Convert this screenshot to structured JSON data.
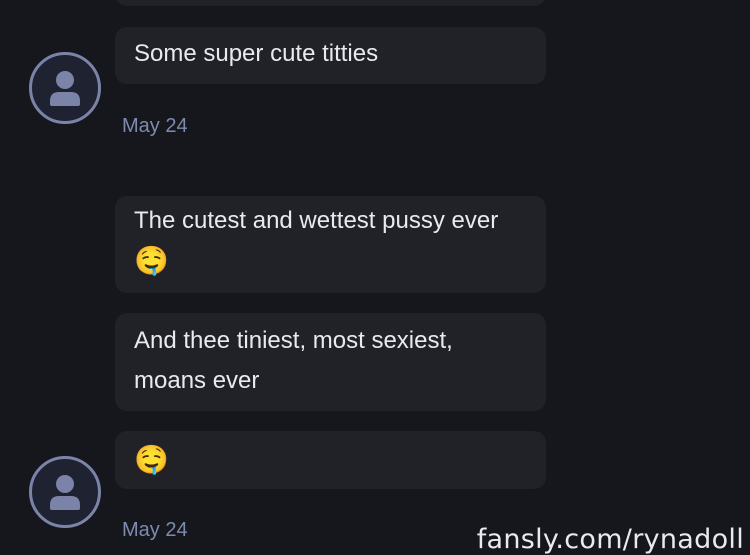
{
  "messages": [
    {
      "text": "Some super cute titties",
      "date": "May 24"
    },
    {
      "line1": "The cutest and wettest pussy ever",
      "emoji": "🤤"
    },
    {
      "line1": "And thee tiniest, most sexiest,",
      "line2": "moans ever"
    },
    {
      "emoji": "🤤",
      "date": "May 24"
    }
  ],
  "watermark": "fansly.com/rynadoll",
  "colors": {
    "background": "#16171c",
    "bubble": "#212227",
    "avatar_ring": "#7b84a8",
    "date_text": "#7e8aae"
  },
  "icons": {
    "avatar": "user-silhouette-icon",
    "emoji": "drooling-face-emoji"
  }
}
